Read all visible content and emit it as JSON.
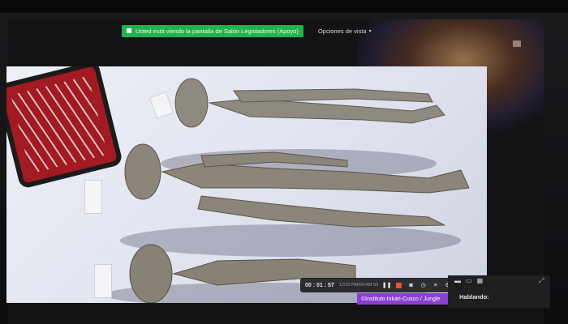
{
  "zoom": {
    "share_banner": "Usted está viendo la pantalla de Salón Legisladores (Apoyo)",
    "view_options": "Opciones de vista",
    "speaking_label": "Hablando:"
  },
  "player": {
    "elapsed": "00 : 01 : 57",
    "timestamp": "12/10 PM/09 AM 50",
    "icons": [
      "pause-icon",
      "record-icon",
      "camera-icon",
      "timer-icon",
      "bars-icon",
      "settings-icon",
      "close-icon"
    ]
  },
  "shared_content": {
    "credit": "©Instituto Inkari-Cusco / Jungle"
  },
  "colors": {
    "banner_green": "#23b14d",
    "credit_purple": "#8b3fd1",
    "record_orange": "#e8533a"
  }
}
